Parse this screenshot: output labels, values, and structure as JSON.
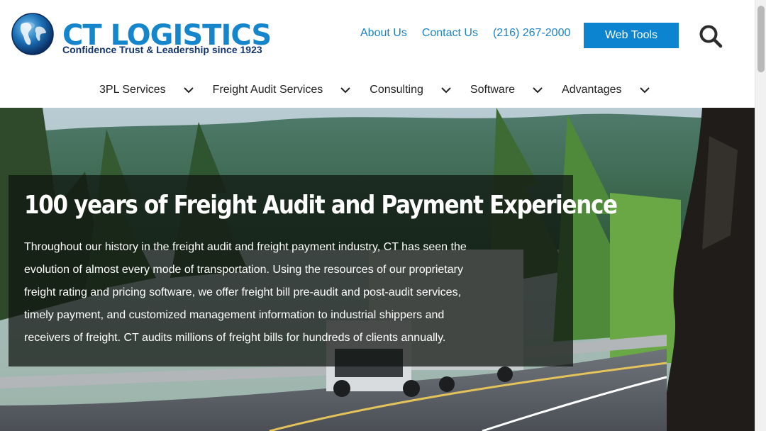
{
  "header": {
    "logo": {
      "name": "CT LOGISTICS",
      "tagline": "Confidence Trust & Leadership since 1923",
      "icon": "globe-icon"
    },
    "top_links": [
      {
        "label": "About Us"
      },
      {
        "label": "Contact Us"
      },
      {
        "label": "(216) 267-2000"
      }
    ],
    "web_tools_label": "Web Tools",
    "search_icon": "search-icon"
  },
  "nav": {
    "items": [
      {
        "label": "3PL Services",
        "icon": "chevron-down-icon"
      },
      {
        "label": "Freight Audit Services",
        "icon": "chevron-down-icon"
      },
      {
        "label": "Consulting",
        "icon": "chevron-down-icon"
      },
      {
        "label": "Software",
        "icon": "chevron-down-icon"
      },
      {
        "label": "Advantages",
        "icon": "chevron-down-icon"
      }
    ]
  },
  "hero": {
    "headline": "100 years of Freight Audit and Payment Experience",
    "body": "Throughout our history in the freight audit and freight payment industry, CT has seen the evolution of almost every mode of transportation. Using the resources of our proprietary freight rating and pricing software, we offer freight bill pre-audit and post-audit services, timely payment, and customized management information to industrial shippers and receivers of freight. CT audits millions of freight bills for hundreds of clients annually."
  },
  "colors": {
    "brand_blue": "#1586cc",
    "brand_navy": "#14366e",
    "button_blue": "#0d84d0",
    "link_blue": "#1a83c4"
  }
}
